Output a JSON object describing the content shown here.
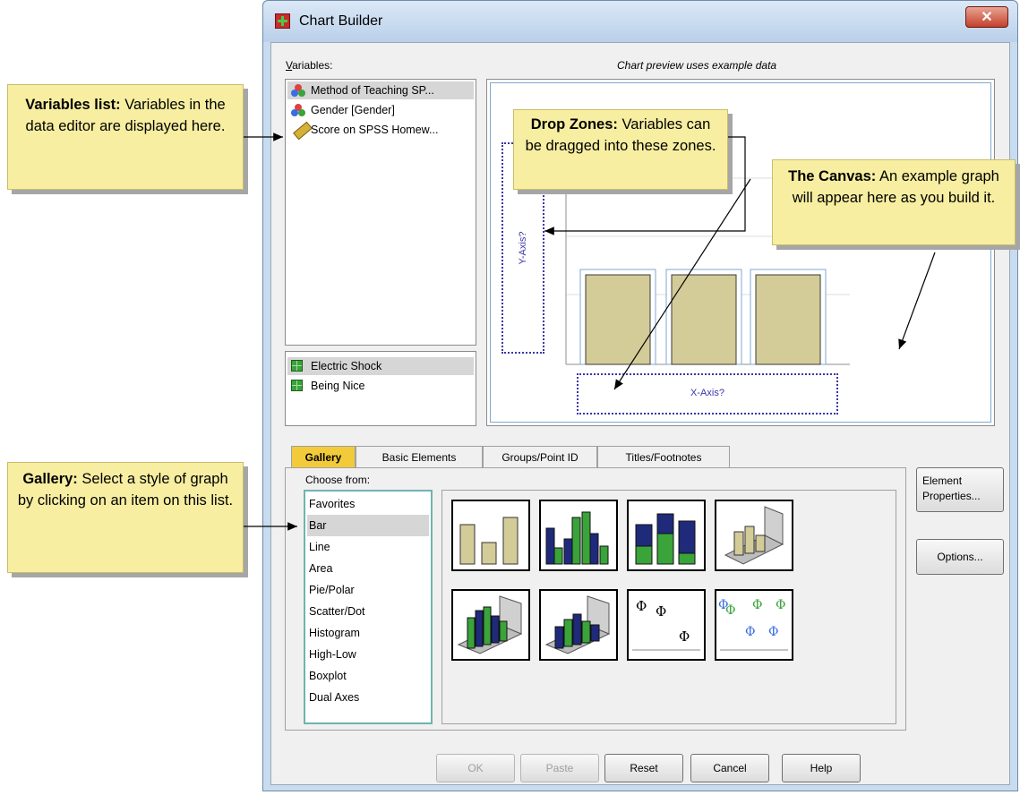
{
  "window": {
    "title": "Chart Builder",
    "close_glyph": "✕"
  },
  "variables": {
    "label_prefix": "V",
    "label_rest": "ariables:",
    "items": [
      {
        "label": "Method of Teaching SP...",
        "icon": "nominal-icon"
      },
      {
        "label": "Gender [Gender]",
        "icon": "nominal-icon"
      },
      {
        "label": "Score on SPSS Homew...",
        "icon": "scale-ruler-icon"
      }
    ],
    "categories": [
      {
        "label": "Electric Shock"
      },
      {
        "label": "Being Nice"
      }
    ]
  },
  "canvas": {
    "header": "Chart preview uses example data",
    "y_axis_zone": "Y-Axis?",
    "x_axis_zone": "X-Axis?"
  },
  "tabs": [
    {
      "label": "Gallery",
      "active": true
    },
    {
      "label": "Basic Elements",
      "active": false
    },
    {
      "label": "Groups/Point ID",
      "active": false
    },
    {
      "label": "Titles/Footnotes",
      "active": false
    }
  ],
  "gallery": {
    "choose_from": "Choose from:",
    "items": [
      "Favorites",
      "Bar",
      "Line",
      "Area",
      "Pie/Polar",
      "Scatter/Dot",
      "Histogram",
      "High-Low",
      "Boxplot",
      "Dual Axes"
    ],
    "selected": "Bar"
  },
  "side_buttons": {
    "element_properties": "Element Properties...",
    "options": "Options..."
  },
  "footer_buttons": [
    {
      "label": "OK",
      "enabled": false
    },
    {
      "label": "Paste",
      "enabled": false
    },
    {
      "label": "Reset",
      "enabled": true
    },
    {
      "label": "Cancel",
      "enabled": true
    },
    {
      "label": "Help",
      "enabled": true
    }
  ],
  "callouts": {
    "variables": {
      "bold": "Variables list:",
      "text": " Variables in the data editor are displayed here."
    },
    "drop_zones": {
      "bold": "Drop Zones:",
      "text": " Variables can be dragged into these zones."
    },
    "canvas": {
      "bold": "The Canvas:",
      "text": " An example graph will appear here as you build it."
    },
    "gallery": {
      "bold": "Gallery:",
      "text": " Select a style of graph by clicking on an item on this list."
    }
  },
  "colors": {
    "callout_bg": "#f7eea1",
    "active_tab": "#f3cb3a",
    "bar_fill": "#d3cc99",
    "dropzone": "#3b37a8",
    "green": "#3aa33a",
    "navy": "#1f2a7a"
  }
}
